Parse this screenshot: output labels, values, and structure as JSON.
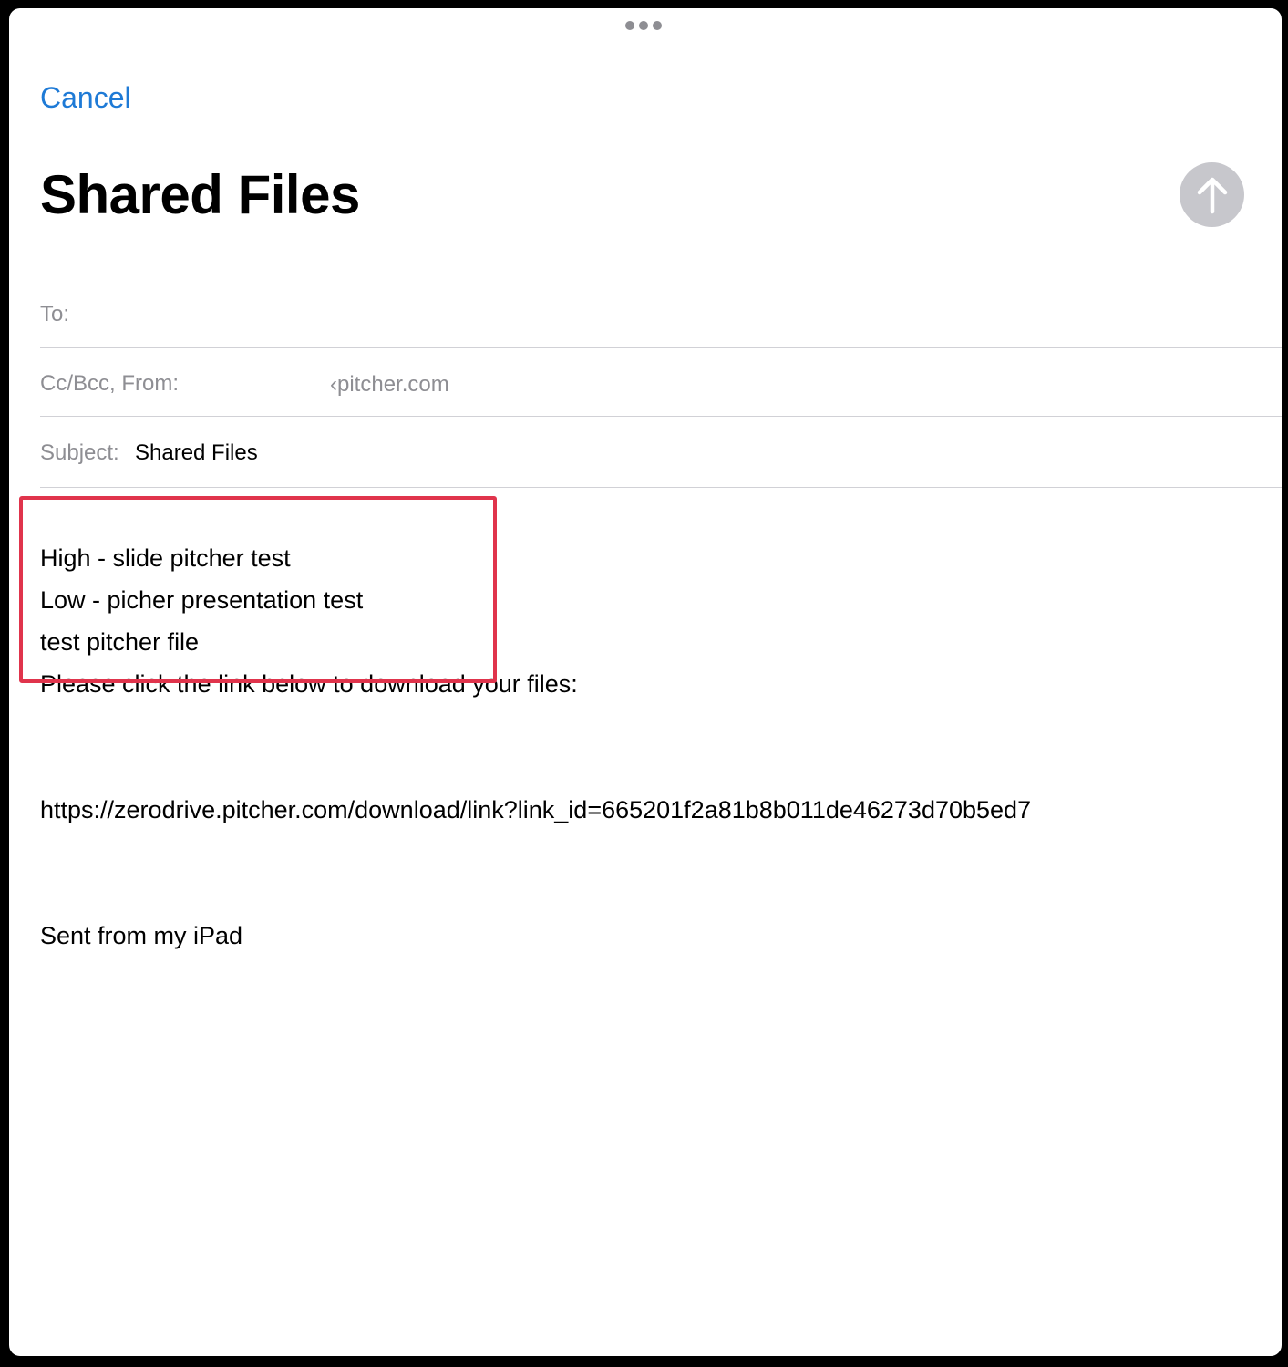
{
  "compose": {
    "cancel_label": "Cancel",
    "title": "Shared Files"
  },
  "fields": {
    "to_label": "To:",
    "from_label": "Cc/Bcc, From:",
    "from_value": "‹pitcher.com",
    "subject_label": "Subject:",
    "subject_value": "Shared Files"
  },
  "body": {
    "lines": [
      "High - slide pitcher test",
      "Low - picher presentation test",
      "test pitcher file",
      "Please click the link below to download your files:"
    ],
    "link": "https://zerodrive.pitcher.com/download/link?link_id=665201f2a81b8b011de46273d70b5ed7",
    "signature": "Sent from my iPad"
  },
  "icons": {
    "send": "arrow-up-icon",
    "grabber": "more-dots-icon"
  },
  "colors": {
    "accent": "#1e7ad6",
    "send_disabled": "#c7c7cc",
    "highlight": "#e0344c"
  }
}
